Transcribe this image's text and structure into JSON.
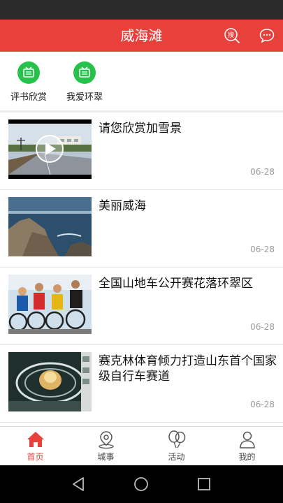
{
  "header": {
    "title": "威海滩",
    "search_icon": "search-icon",
    "message_icon": "chat-bubble-icon",
    "color": "#e8413c"
  },
  "categories": [
    {
      "label": "评书欣赏",
      "icon": "tv-icon",
      "color": "#27c24c"
    },
    {
      "label": "我爱环翠",
      "icon": "tv-icon",
      "color": "#27c24c"
    }
  ],
  "articles": [
    {
      "title": "请您欣赏加雪景",
      "date": "06-28",
      "has_video": true
    },
    {
      "title": "美丽威海",
      "date": "06-28",
      "has_video": false
    },
    {
      "title": "全国山地车公开赛花落环翠区",
      "date": "06-28",
      "has_video": false
    },
    {
      "title": "赛克林体育倾力打造山东首个国家级自行车赛道",
      "date": "06-28",
      "has_video": false
    }
  ],
  "tabs": [
    {
      "label": "首页",
      "icon": "home-icon",
      "active": true
    },
    {
      "label": "城事",
      "icon": "location-pin-icon",
      "active": false
    },
    {
      "label": "活动",
      "icon": "balloons-icon",
      "active": false
    },
    {
      "label": "我的",
      "icon": "person-icon",
      "active": false
    }
  ],
  "active_color": "#e8413c"
}
